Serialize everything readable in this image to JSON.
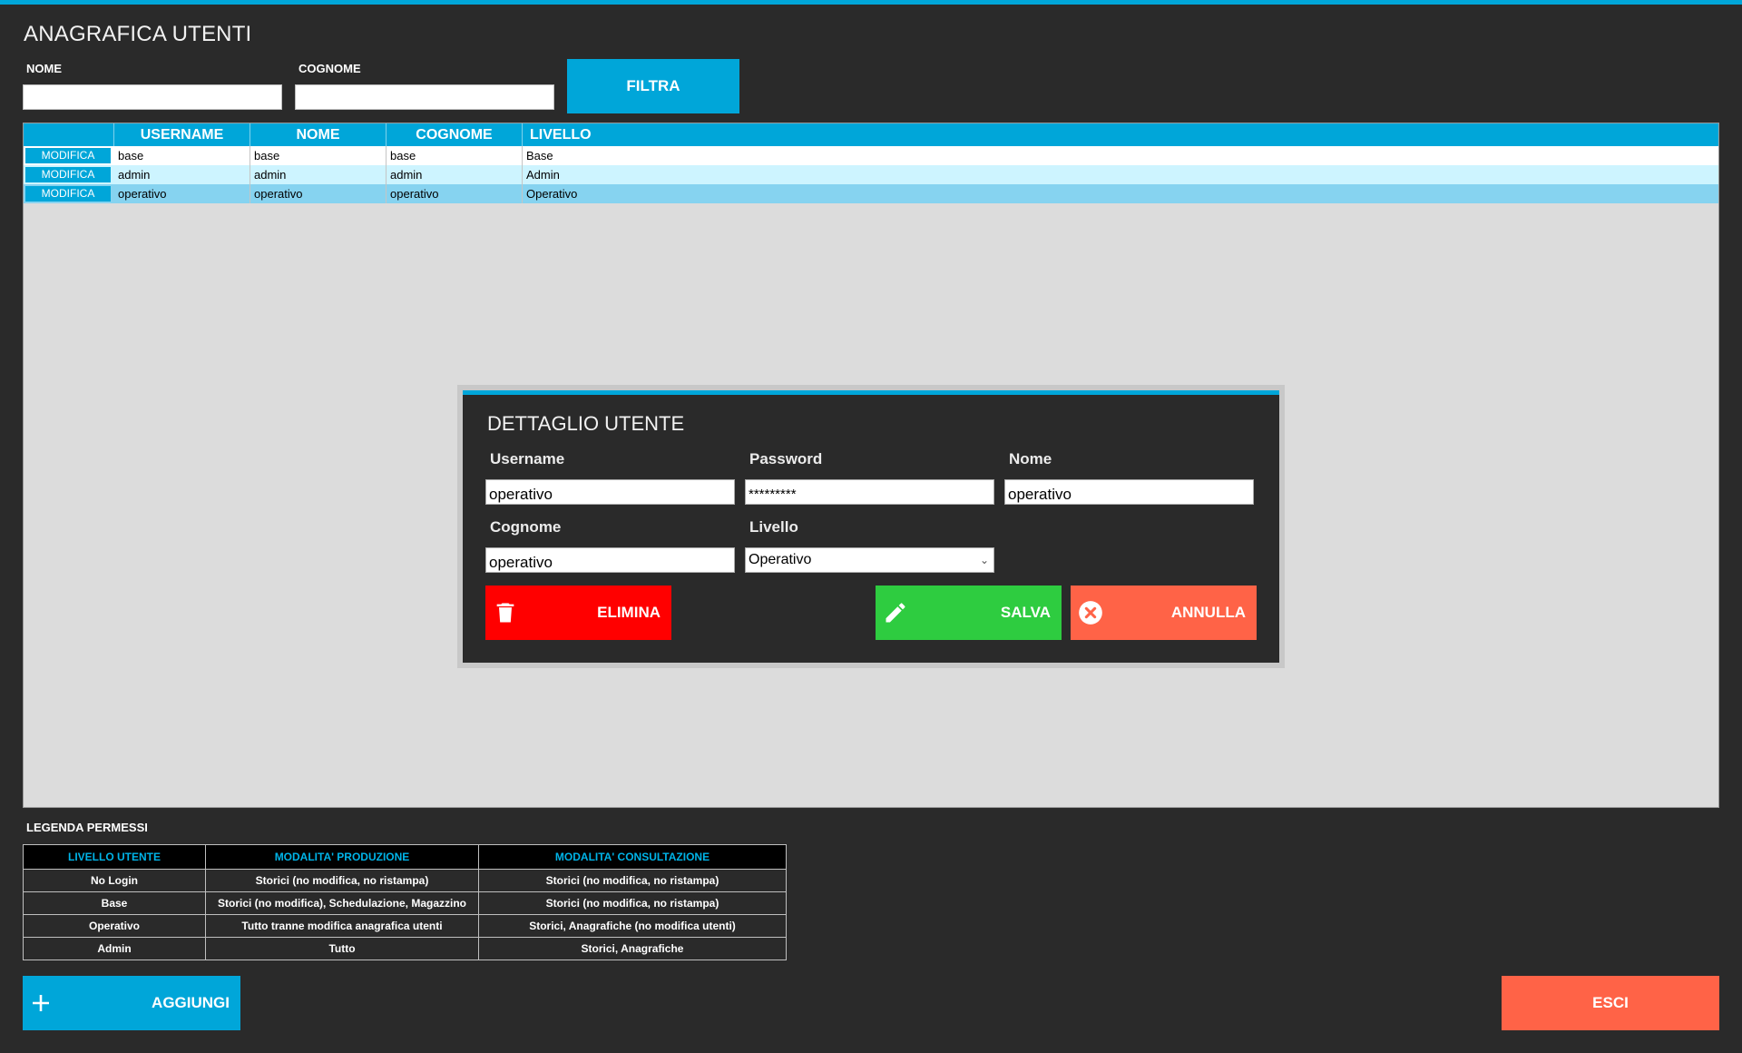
{
  "page": {
    "title": "ANAGRAFICA UTENTI"
  },
  "filter": {
    "nome_label": "NOME",
    "nome_value": "",
    "cognome_label": "COGNOME",
    "cognome_value": "",
    "filtra_label": "FILTRA"
  },
  "grid": {
    "columns": [
      "USERNAME",
      "NOME",
      "COGNOME",
      "LIVELLO"
    ],
    "action_label": "MODIFICA",
    "rows": [
      {
        "username": "base",
        "nome": "base",
        "cognome": "base",
        "livello": "Base"
      },
      {
        "username": "admin",
        "nome": "admin",
        "cognome": "admin",
        "livello": "Admin"
      },
      {
        "username": "operativo",
        "nome": "operativo",
        "cognome": "operativo",
        "livello": "Operativo"
      }
    ]
  },
  "dialog": {
    "title": "DETTAGLIO UTENTE",
    "username_label": "Username",
    "username_value": "operativo",
    "password_label": "Password",
    "password_value": "*********",
    "nome_label": "Nome",
    "nome_value": "operativo",
    "cognome_label": "Cognome",
    "cognome_value": "operativo",
    "livello_label": "Livello",
    "livello_value": "Operativo",
    "elimina_label": "ELIMINA",
    "salva_label": "SALVA",
    "annulla_label": "ANNULLA"
  },
  "legend": {
    "title": "LEGENDA PERMESSI",
    "headers": [
      "LIVELLO UTENTE",
      "MODALITA' PRODUZIONE",
      "MODALITA' CONSULTAZIONE"
    ],
    "rows": [
      [
        "No Login",
        "Storici (no modifica, no ristampa)",
        "Storici (no modifica, no ristampa)"
      ],
      [
        "Base",
        "Storici (no modifica), Schedulazione, Magazzino",
        "Storici (no modifica, no ristampa)"
      ],
      [
        "Operativo",
        "Tutto tranne modifica anagrafica utenti",
        "Storici, Anagrafiche (no modifica utenti)"
      ],
      [
        "Admin",
        "Tutto",
        "Storici, Anagrafiche"
      ]
    ]
  },
  "footer": {
    "aggiungi_label": "AGGIUNGI",
    "esci_label": "ESCI"
  },
  "colors": {
    "accent": "#00a6d9",
    "danger": "#ff0000",
    "success": "#2ecc40",
    "cancel": "#ff6347",
    "background": "#2a2a2a"
  },
  "icons": {
    "elimina": "trash-icon",
    "salva": "pencil-icon",
    "annulla": "close-circle-icon",
    "aggiungi": "plus-icon",
    "livello_select": "chevron-down-icon"
  }
}
